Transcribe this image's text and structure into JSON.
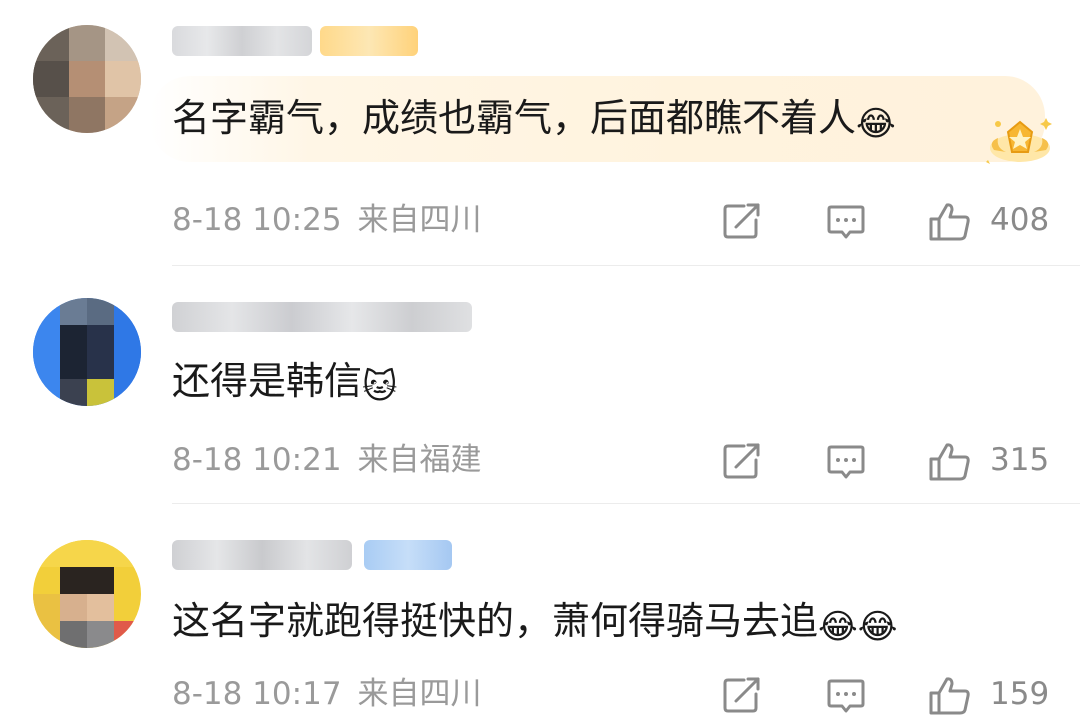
{
  "comments": [
    {
      "text": "名字霸气，成绩也霸气，后面都瞧不着人",
      "emoji": "😂",
      "time": "8-18 10:25",
      "location": "来自四川",
      "likes": "408",
      "highlighted": true,
      "badge_color": "#ffd98a"
    },
    {
      "text": "还得是韩信",
      "emoji": "🐱",
      "time": "8-18 10:21",
      "location": "来自福建",
      "likes": "315",
      "highlighted": false
    },
    {
      "text": "这名字就跑得挺快的，萧何得骑马去追",
      "emoji": "😂😂",
      "time": "8-18 10:17",
      "location": "来自四川",
      "likes": "159",
      "highlighted": false,
      "badge_color": "#a9ccf4"
    }
  ],
  "icons": {
    "share": "share-icon",
    "reply": "comment-icon",
    "like": "thumbs-up-icon",
    "hot": "hot-comment-star-badge-icon"
  },
  "colors": {
    "text": "#1a1a1a",
    "meta": "#9a9a9a",
    "highlight": "#fff3de",
    "hot_badge": "#f7b733"
  }
}
